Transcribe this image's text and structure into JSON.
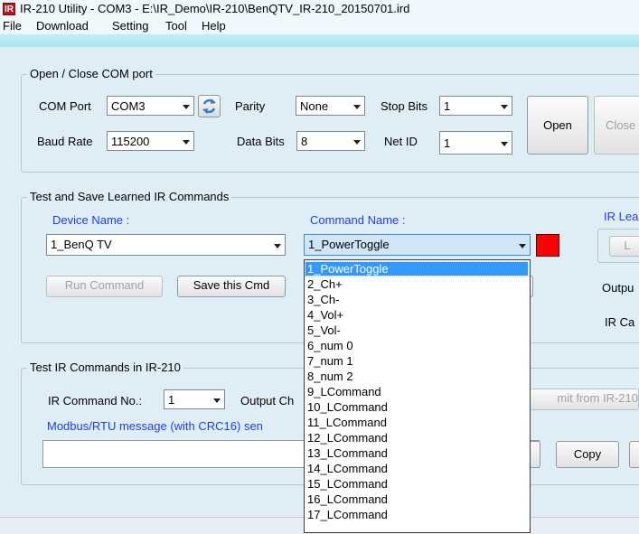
{
  "window": {
    "title": "IR-210 Utility - COM3 - E:\\IR_Demo\\IR-210\\BenQTV_IR-210_20150701.ird",
    "icon_text": "IR"
  },
  "menu": [
    "File",
    "Download",
    "Setting",
    "Tool",
    "Help"
  ],
  "com_group": {
    "title": "Open / Close COM port",
    "com_port_label": "COM Port",
    "com_port_value": "COM3",
    "parity_label": "Parity",
    "parity_value": "None",
    "stop_bits_label": "Stop Bits",
    "stop_bits_value": "1",
    "baud_rate_label": "Baud Rate",
    "baud_rate_value": "115200",
    "data_bits_label": "Data Bits",
    "data_bits_value": "8",
    "net_id_label": "Net ID",
    "net_id_value": "1",
    "open_button": "Open",
    "close_button": "Close"
  },
  "learn_group": {
    "title": "Test and Save Learned IR Commands",
    "device_name_label": "Device Name :",
    "device_name_value": "1_BenQ TV",
    "command_name_label": "Command Name :",
    "command_name_value": "1_PowerToggle",
    "ir_learn_label": "IR Lea",
    "learn_button": "L",
    "run_command_button": "Run Command",
    "save_cmd_button": "Save this Cmd",
    "output_label": "Outpu",
    "ir_ca_label": "IR Ca",
    "status_color": "#ff0000"
  },
  "test_group": {
    "title": "Test IR Commands in IR-210",
    "ir_command_no_label": "IR Command No.:",
    "ir_command_no_value": "1",
    "output_ch_label": "Output Ch",
    "transmit_button": "mit from IR-210",
    "modbus_label": "Modbus/RTU message (with CRC16) sen",
    "copy_button": "Copy"
  },
  "command_dropdown": {
    "selected_index": 0,
    "items": [
      "1_PowerToggle",
      "2_Ch+",
      "3_Ch-",
      "4_Vol+",
      "5_Vol-",
      "6_num 0",
      "7_num 1",
      "8_num 2",
      "9_LCommand",
      "10_LCommand",
      "11_LCommand",
      "12_LCommand",
      "13_LCommand",
      "14_LCommand",
      "15_LCommand",
      "16_LCommand",
      "17_LCommand"
    ]
  }
}
